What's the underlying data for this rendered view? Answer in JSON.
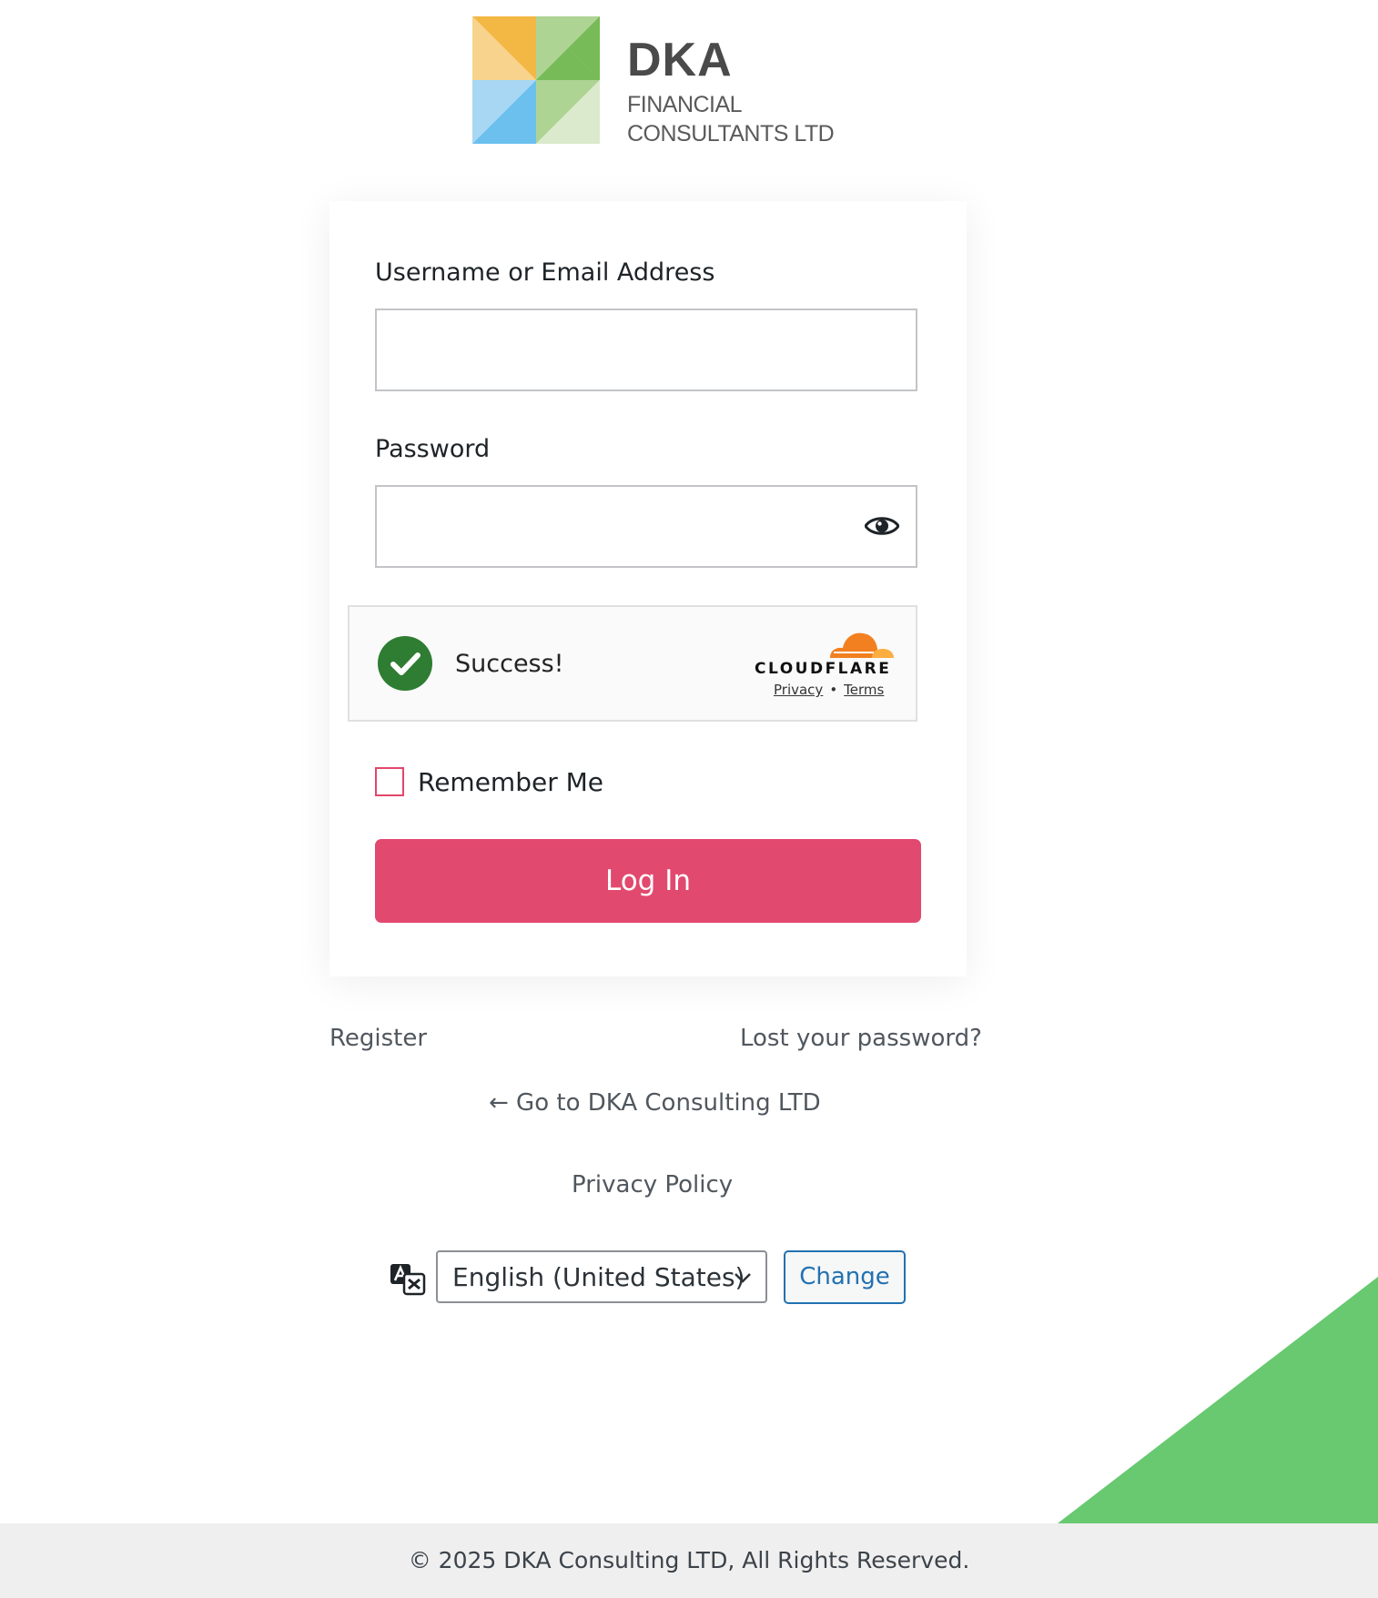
{
  "brand": {
    "title": "DKA",
    "line1": "FINANCIAL",
    "line2": "CONSULTANTS LTD",
    "colors": {
      "orange": "#f3b843",
      "light_orange": "#f7d38d",
      "green": "#77bb58",
      "light_green": "#aed493",
      "pale_green": "#dbe9cd",
      "blue": "#6bc0ee",
      "light_blue": "#a7d7f2"
    }
  },
  "login": {
    "username_label": "Username or Email Address",
    "username_value": "",
    "password_label": "Password",
    "password_value": "",
    "show_password_icon": "eye-icon",
    "remember_label": "Remember Me",
    "remember_checked": false,
    "submit_label": "Log In",
    "accent_color": "#e2496e"
  },
  "captcha": {
    "status": "Success!",
    "provider": "CLOUDFLARE",
    "privacy_label": "Privacy",
    "separator": "•",
    "terms_label": "Terms",
    "status_color": "#2e7d32",
    "cloud_color": "#f38020"
  },
  "links": {
    "register": "Register",
    "lost_password": "Lost your password?",
    "back_to_site": "← Go to DKA Consulting LTD",
    "privacy_policy": "Privacy Policy"
  },
  "language": {
    "icon": "translate-icon",
    "selected": "English (United States)",
    "change_label": "Change",
    "button_color": "#2271b1"
  },
  "decoration": {
    "triangle_color": "#68c970"
  },
  "footer": {
    "text": "© 2025 DKA Consulting LTD, All Rights Reserved."
  }
}
